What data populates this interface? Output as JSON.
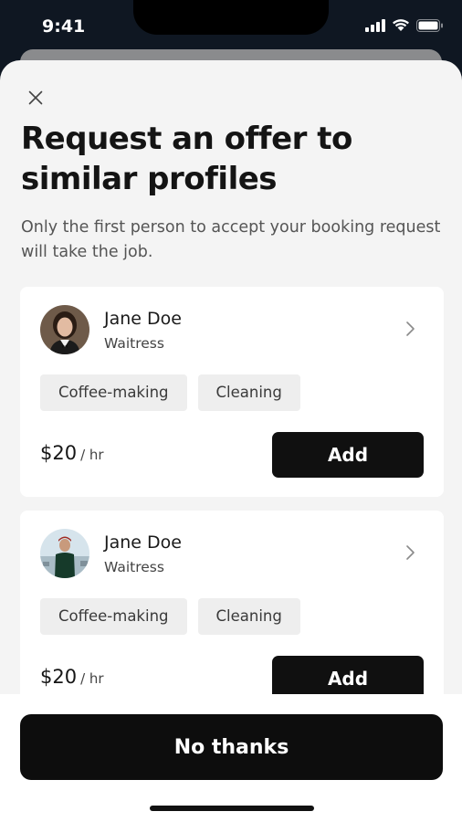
{
  "status_bar": {
    "time": "9:41"
  },
  "sheet": {
    "title": "Request an offer to similar profiles",
    "subtitle": "Only the first person to accept your booking request will take the job."
  },
  "workers": [
    {
      "name": "Jane Doe",
      "role": "Waitress",
      "skills": [
        "Coffee-making",
        "Cleaning"
      ],
      "rate": "$20",
      "rate_unit": "/ hr",
      "add_label": "Add"
    },
    {
      "name": "Jane Doe",
      "role": "Waitress",
      "skills": [
        "Coffee-making",
        "Cleaning"
      ],
      "rate": "$20",
      "rate_unit": "/ hr",
      "add_label": "Add"
    }
  ],
  "footer": {
    "no_thanks_label": "No thanks"
  },
  "icons": {
    "close": "close-icon",
    "chevron": "chevron-right-icon",
    "signal": "signal-icon",
    "wifi": "wifi-icon",
    "battery": "battery-icon"
  },
  "colors": {
    "primary_button": "#101010",
    "sheet_background": "#f4f4f4",
    "tag_background": "#eeeeee"
  }
}
